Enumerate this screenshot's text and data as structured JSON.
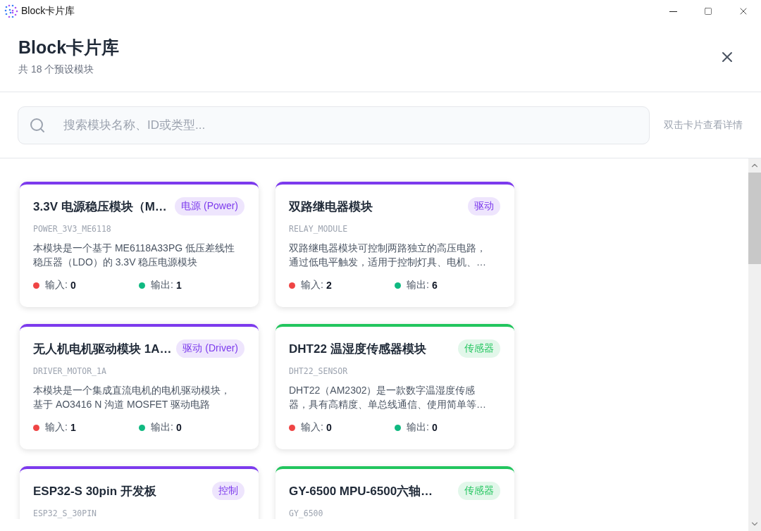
{
  "window": {
    "title": "Block卡片库"
  },
  "header": {
    "title": "Block卡片库",
    "subtitle": "共 18 个预设模块"
  },
  "search": {
    "placeholder": "搜索模块名称、ID或类型...",
    "hint": "双击卡片查看详情"
  },
  "cards": [
    {
      "title": "3.3V 电源稳压模块（M…",
      "tag": "电源 (Power)",
      "color": "#7c3aed",
      "id": "POWER_3V3_ME6118",
      "description": "本模块是一个基于 ME6118A33PG 低压差线性稳压器（LDO）的 3.3V 稳压电源模块",
      "input_label": "输入:",
      "input": "0",
      "output_label": "输出:",
      "output": "1"
    },
    {
      "title": "双路继电器模块",
      "tag": "驱动",
      "color": "#7c3aed",
      "id": "RELAY_MODULE",
      "description": "双路继电器模块可控制两路独立的高压电路，通过低电平触发，适用于控制灯具、电机、…",
      "input_label": "输入:",
      "input": "2",
      "output_label": "输出:",
      "output": "6"
    },
    {
      "title": "无人机电机驱动模块 1A…",
      "tag": "驱动 (Driver)",
      "color": "#7c3aed",
      "id": "DRIVER_MOTOR_1A",
      "description": "本模块是一个集成直流电机的电机驱动模块，基于 AO3416 N 沟道 MOSFET 驱动电路",
      "input_label": "输入:",
      "input": "1",
      "output_label": "输出:",
      "output": "0"
    },
    {
      "title": "DHT22 温湿度传感器模块",
      "tag": "传感器",
      "color": "#22c55e",
      "id": "DHT22_SENSOR",
      "description": "DHT22（AM2302）是一款数字温湿度传感器，具有高精度、单总线通信、使用简单等…",
      "input_label": "输入:",
      "input": "0",
      "output_label": "输出:",
      "output": "0"
    },
    {
      "title": "ESP32-S 30pin 开发板",
      "tag": "控制",
      "color": "#7c3aed",
      "id": "ESP32_S_30PIN"
    },
    {
      "title": "GY-6500 MPU-6500六轴…",
      "tag": "传感器",
      "color": "#22c55e",
      "id": "GY_6500"
    }
  ]
}
